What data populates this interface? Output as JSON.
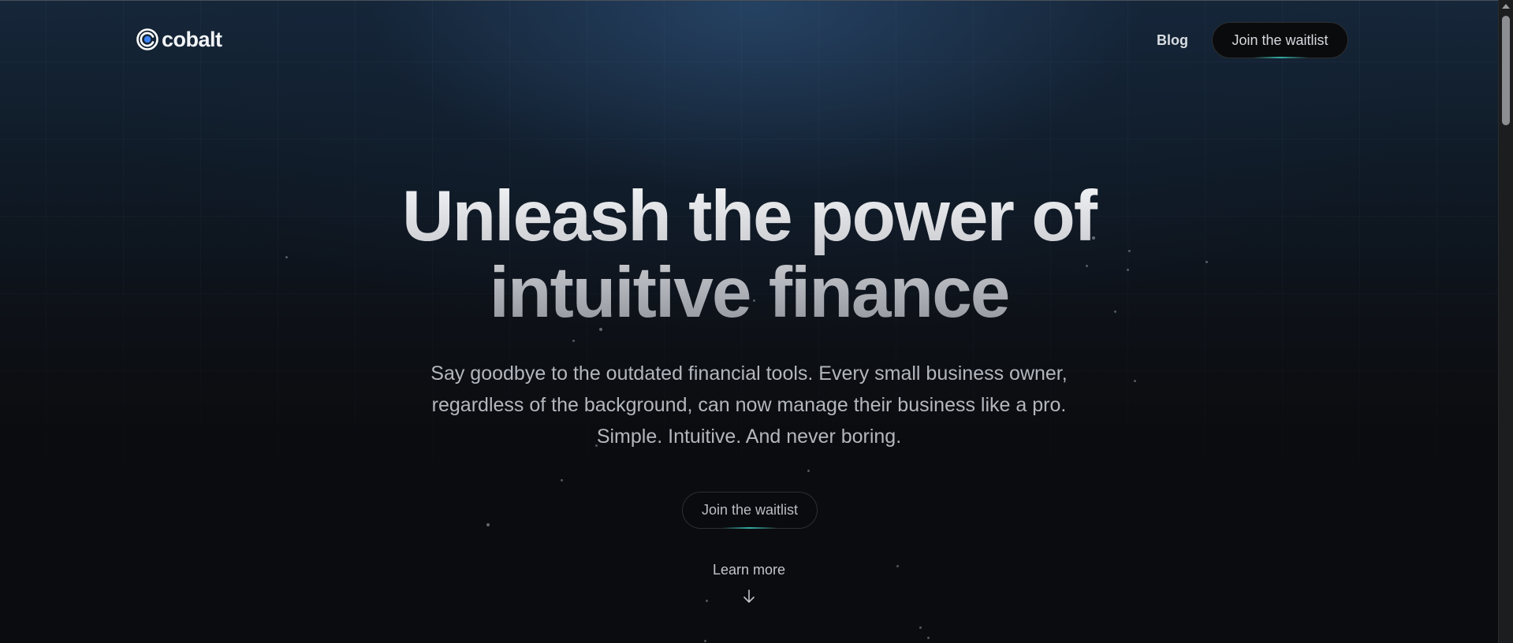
{
  "header": {
    "logo_text": "cobalt",
    "logo_icon": "cobalt-logo-icon",
    "nav": {
      "blog_label": "Blog",
      "waitlist_label": "Join the waitlist"
    }
  },
  "hero": {
    "title_line1": "Unleash the power of",
    "title_line2": "intuitive finance",
    "subtitle_line1": "Say goodbye to the outdated financial tools. Every small business owner,",
    "subtitle_line2": "regardless of the background, can now manage their business like a pro.",
    "subtitle_line3": "Simple. Intuitive. And never boring.",
    "cta_label": "Join the waitlist",
    "learn_more_label": "Learn more",
    "learn_more_icon": "arrow-down-icon"
  },
  "colors": {
    "accent_glow": "#38beb4",
    "background": "#0b0c0f",
    "header_gradient": "#16273a"
  }
}
